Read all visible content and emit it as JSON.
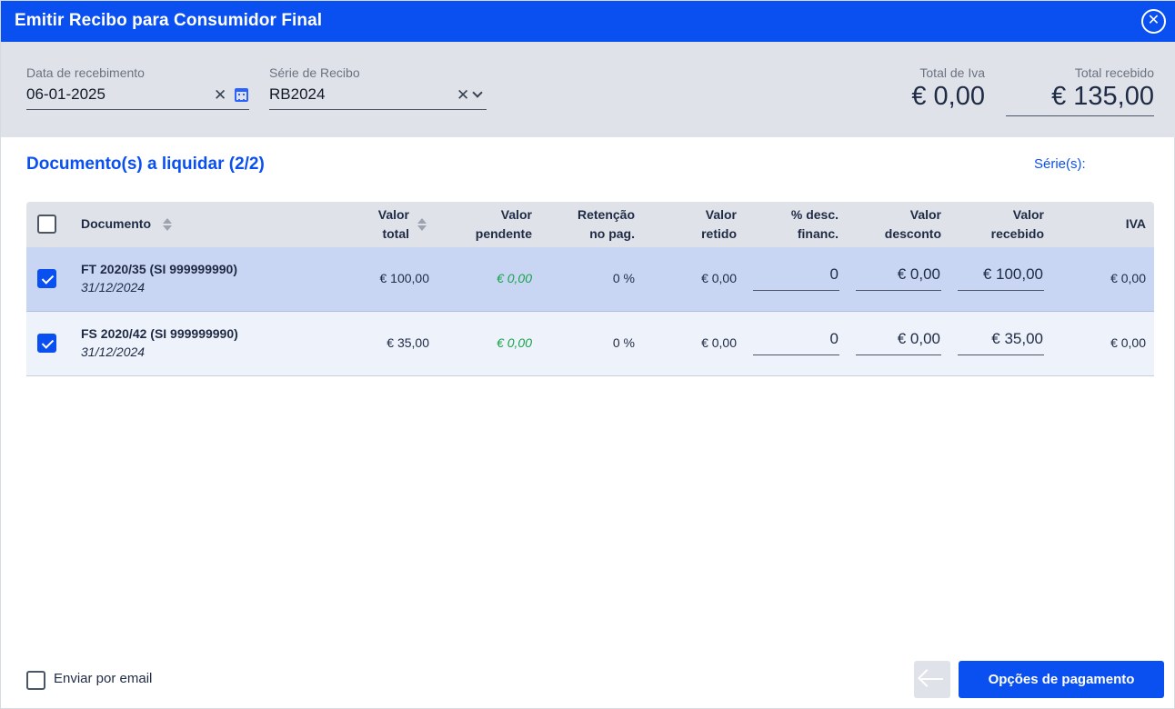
{
  "dialog": {
    "title": "Emitir Recibo para Consumidor Final",
    "close_icon": "close-circle-icon"
  },
  "form": {
    "date_label": "Data de recebimento",
    "date_value": "06-01-2025",
    "series_label": "Série de Recibo",
    "series_value": "RB2024"
  },
  "totals": {
    "iva_label": "Total de Iva",
    "iva_value": "€ 0,00",
    "received_label": "Total recebido",
    "received_value": "€ 135,00"
  },
  "section": {
    "title": "Documento(s) a liquidar (2/2)",
    "series_link": "Série(s):"
  },
  "table": {
    "headers": {
      "documento": "Documento",
      "valor_total_1": "Valor",
      "valor_total_2": "total",
      "valor_pendente_1": "Valor",
      "valor_pendente_2": "pendente",
      "retencao_1": "Retenção",
      "retencao_2": "no pag.",
      "valor_retido_1": "Valor",
      "valor_retido_2": "retido",
      "desc_financ_1": "% desc.",
      "desc_financ_2": "financ.",
      "valor_desconto_1": "Valor",
      "valor_desconto_2": "desconto",
      "valor_recebido_1": "Valor",
      "valor_recebido_2": "recebido",
      "iva": "IVA"
    },
    "rows": [
      {
        "checked": true,
        "document": "FT 2020/35 (SI 999999990)",
        "date": "31/12/2024",
        "valor_total": "€ 100,00",
        "valor_pendente": "€ 0,00",
        "retencao": "0 %",
        "valor_retido": "€ 0,00",
        "desc_financ": "0",
        "valor_desconto": "€ 0,00",
        "valor_recebido": "€ 100,00",
        "iva": "€ 0,00"
      },
      {
        "checked": true,
        "document": "FS 2020/42 (SI 999999990)",
        "date": "31/12/2024",
        "valor_total": "€ 35,00",
        "valor_pendente": "€ 0,00",
        "retencao": "0 %",
        "valor_retido": "€ 0,00",
        "desc_financ": "0",
        "valor_desconto": "€ 0,00",
        "valor_recebido": "€ 35,00",
        "iva": "€ 0,00"
      }
    ]
  },
  "footer": {
    "email_label": "Enviar por email",
    "email_checked": false,
    "payment_button": "Opções de pagamento",
    "back_icon": "arrow-left-icon"
  },
  "colors": {
    "primary": "#0a50f0",
    "header_bg": "#dfe3e9",
    "selected_row": "#c9d6f3",
    "pending_green": "#16a34a"
  }
}
